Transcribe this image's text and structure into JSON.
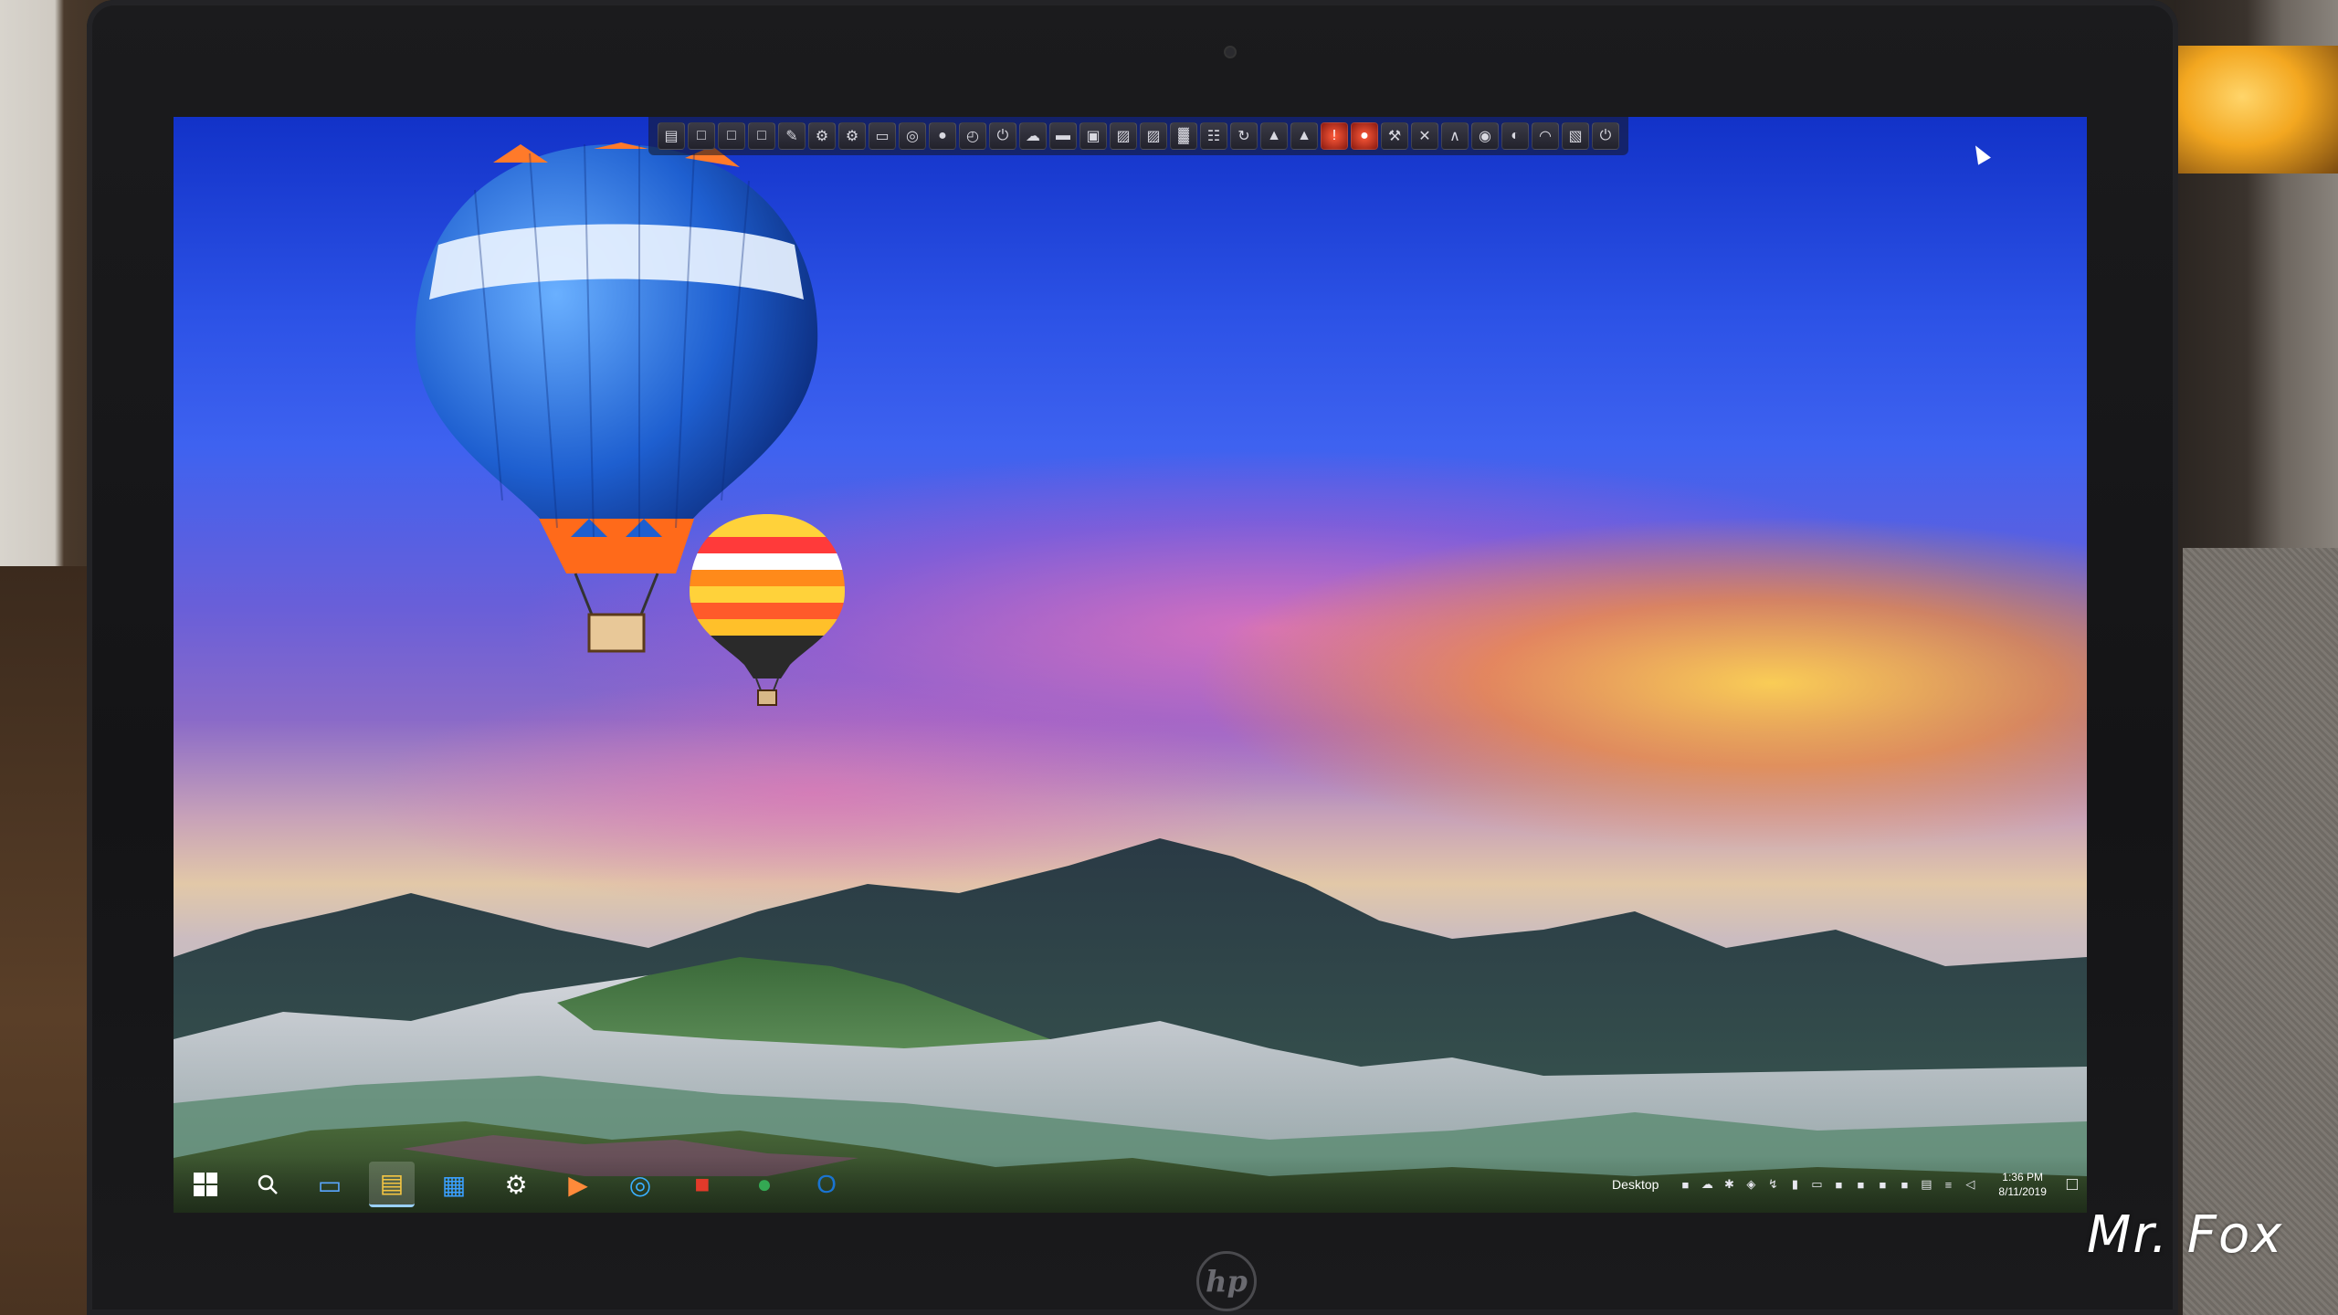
{
  "watermark": "Mr. Fox",
  "brand_logo": "hp",
  "top_dock": {
    "icons": [
      "folder-icon",
      "window-icon",
      "window-icon",
      "window-icon",
      "pen-icon",
      "gear-icon",
      "gear-icon",
      "monitor-icon",
      "disc-icon",
      "globe-icon",
      "clock-icon",
      "power-icon",
      "cloud-icon",
      "drive-icon",
      "terminal-icon",
      "image-icon",
      "image-icon",
      "chart-icon",
      "grid-icon",
      "refresh-icon",
      "mountain-icon",
      "mountain-icon",
      "alert-icon",
      "stop-icon",
      "tools-icon",
      "x-icon",
      "graph-icon",
      "target-icon",
      "eye-icon",
      "arc-icon",
      "layers-icon",
      "power-icon"
    ]
  },
  "taskbar": {
    "start_icon": "windows-logo-icon",
    "search_icon": "search-icon",
    "desktop_label": "Desktop",
    "time": "1:36 PM",
    "date": "8/11/2019",
    "pinned": [
      {
        "name": "this-pc",
        "icon": "monitor-icon",
        "color": "#5aa6ff"
      },
      {
        "name": "file-explorer",
        "icon": "folder-icon",
        "color": "#f4c542",
        "active": true
      },
      {
        "name": "store",
        "icon": "store-icon",
        "color": "#3aa0ff"
      },
      {
        "name": "settings",
        "icon": "gear-icon",
        "color": "#ffffff"
      },
      {
        "name": "media-player",
        "icon": "play-icon",
        "color": "#ff8a3a"
      },
      {
        "name": "media-center",
        "icon": "disc-icon",
        "color": "#3ab0ff"
      },
      {
        "name": "app-red",
        "icon": "app-icon",
        "color": "#e23a2a"
      },
      {
        "name": "chrome",
        "icon": "chrome-icon",
        "color": "#34a853"
      },
      {
        "name": "outlook",
        "icon": "outlook-icon",
        "color": "#1a74d2"
      }
    ],
    "tray_icons": [
      "network-icon",
      "cloud-icon",
      "bluetooth-icon",
      "shield-icon",
      "usb-icon",
      "battery-icon",
      "display-icon",
      "app-icon",
      "app-icon",
      "app-icon",
      "app-icon",
      "folder-icon",
      "wifi-icon",
      "volume-icon"
    ],
    "notification_icon": "notification-icon"
  },
  "colors": {
    "sky_top": "#1232c8",
    "sunset": "#ffd050",
    "balloon_blue": "#1e5fd0",
    "balloon_orange": "#ff6a1a"
  }
}
